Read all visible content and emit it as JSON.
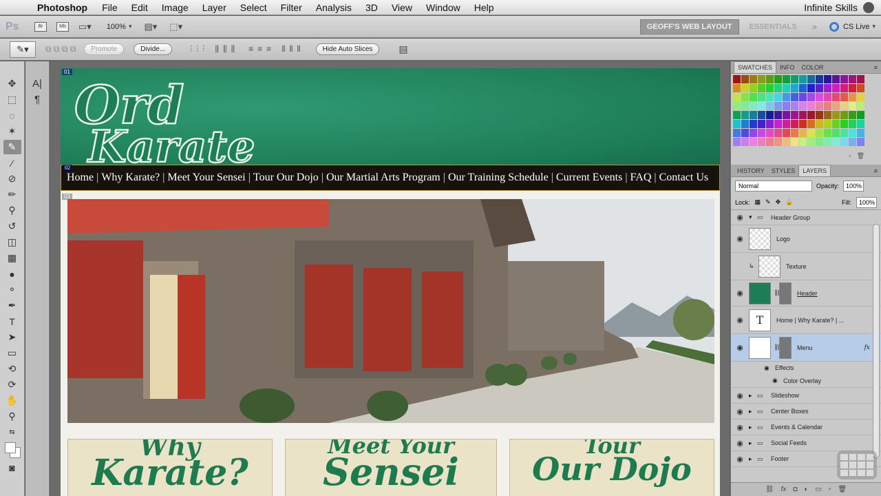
{
  "menubar": {
    "app": "Photoshop",
    "items": [
      "File",
      "Edit",
      "Image",
      "Layer",
      "Select",
      "Filter",
      "Analysis",
      "3D",
      "View",
      "Window",
      "Help"
    ],
    "right": "Infinite Skills"
  },
  "optionsbar": {
    "ps": "Ps",
    "zoom": "100%",
    "workspace_active": "GEOFF'S WEB LAYOUT",
    "workspace_other": "ESSENTIALS",
    "cslive": "CS Live"
  },
  "slicebar": {
    "promote": "Promote",
    "divide": "Divide...",
    "hide_auto": "Hide Auto Slices"
  },
  "document": {
    "slice_01": "01",
    "slice_02": "02",
    "slice_03": "03",
    "logo_line1": "Ord",
    "logo_line2": "Karate",
    "nav": [
      "Home",
      "Why Karate?",
      "Meet Your Sensei",
      "Tour Our Dojo",
      "Our Martial Arts Program",
      "Our Training Schedule",
      "Current Events",
      "FAQ",
      "Contact Us"
    ],
    "nav_sep": "|",
    "boxes": [
      {
        "line1": "Why",
        "line2": "Karate?"
      },
      {
        "line1": "Meet Your",
        "line2": "Sensei"
      },
      {
        "line1": "Tour",
        "line2": "Our Dojo"
      }
    ]
  },
  "panels": {
    "swatch_tabs": [
      "SWATCHES",
      "INFO",
      "COLOR"
    ],
    "layer_tabs": [
      "HISTORY",
      "STYLES",
      "LAYERS"
    ],
    "blend": "Normal",
    "opacity_label": "Opacity:",
    "opacity": "100%",
    "lock_label": "Lock:",
    "fill_label": "Fill:",
    "fill": "100%",
    "layers": [
      {
        "name": "Header Group",
        "kind": "group-open"
      },
      {
        "name": "Logo",
        "kind": "layer"
      },
      {
        "name": "Texture",
        "kind": "clip"
      },
      {
        "name": "Header",
        "kind": "layer"
      },
      {
        "name": "Home | Why Karate? | ...",
        "kind": "text"
      },
      {
        "name": "Menu",
        "kind": "layer-selected",
        "fx": "fx"
      },
      {
        "name": "Effects",
        "kind": "effects"
      },
      {
        "name": "Color Overlay",
        "kind": "effect"
      },
      {
        "name": "Slideshow",
        "kind": "group"
      },
      {
        "name": "Center Boxes",
        "kind": "group"
      },
      {
        "name": "Events & Calendar",
        "kind": "group"
      },
      {
        "name": "Social Feeds",
        "kind": "group"
      },
      {
        "name": "Footer",
        "kind": "group"
      }
    ],
    "text_thumb": "T"
  },
  "colors": {
    "header_green": "#1d7d57",
    "nav_bg": "#17120c",
    "box_title": "#1e7a4f",
    "selected_layer": "#b7cce8"
  }
}
